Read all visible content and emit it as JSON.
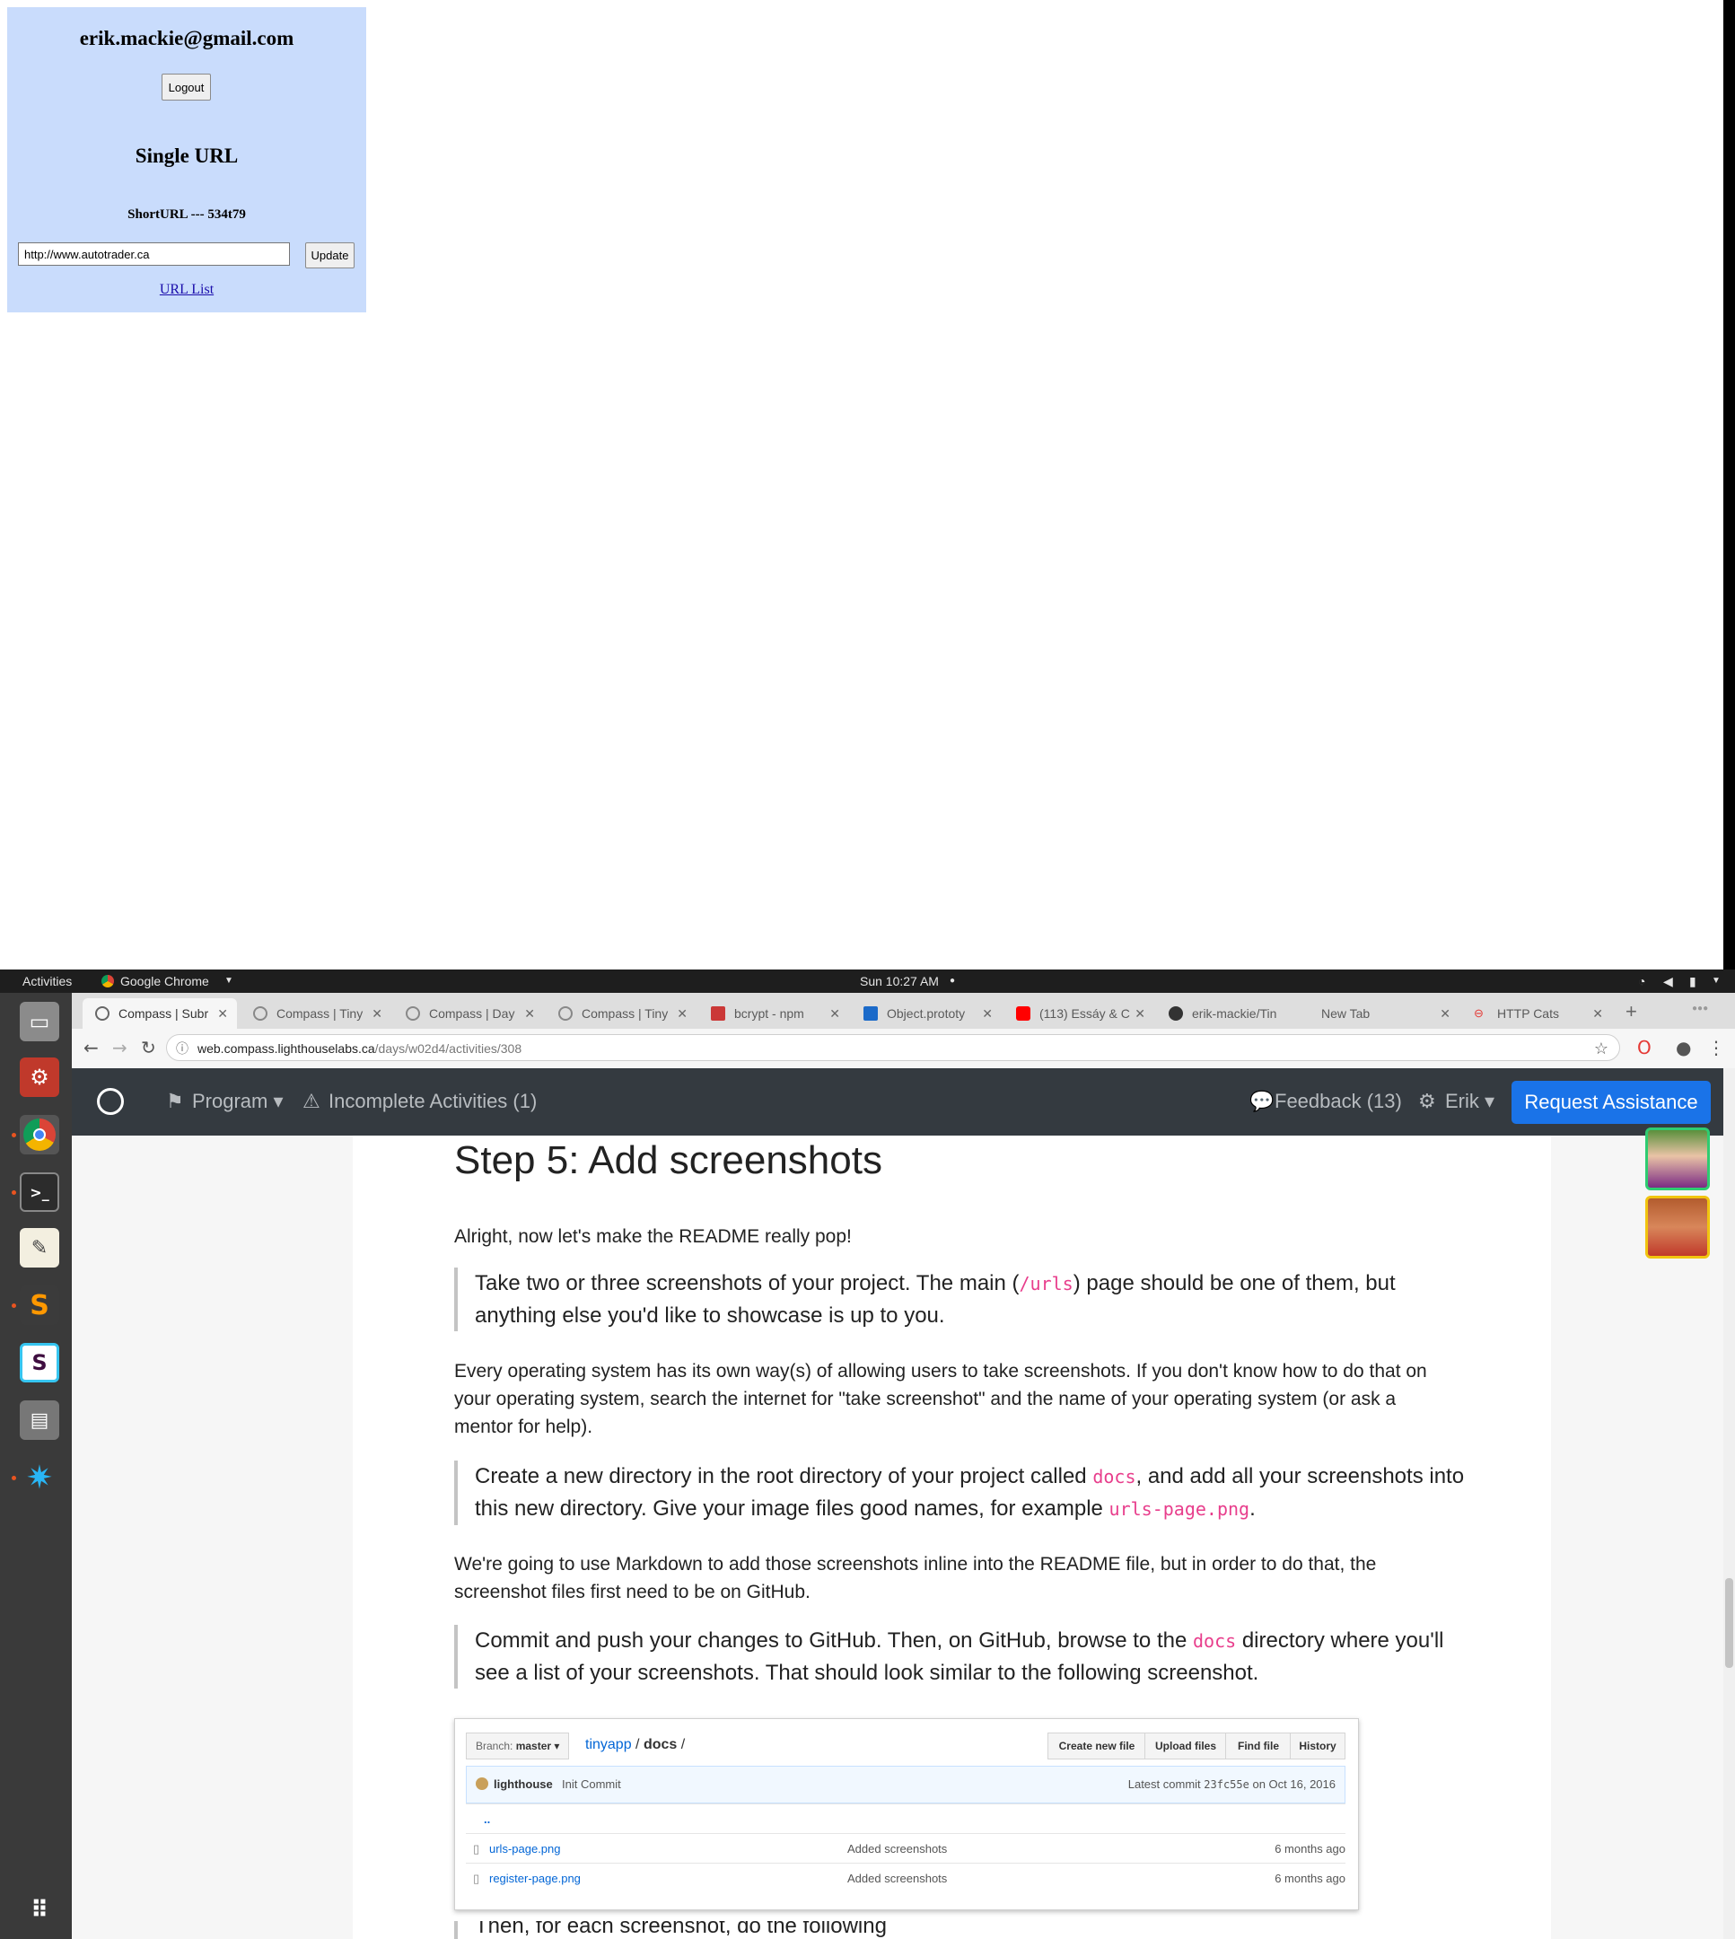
{
  "app": {
    "email": "erik.mackie@gmail.com",
    "logout_label": "Logout",
    "title": "Single URL",
    "shorturl_text": "ShortURL --- 534t79",
    "long_url_value": "http://www.autotrader.ca",
    "update_label": "Update",
    "url_list_link": "URL List"
  },
  "system_bar": {
    "activities": "Activities",
    "app_name": "Google Chrome",
    "clock": "Sun 10:27 AM"
  },
  "browser": {
    "tabs": [
      {
        "label": "Compass | Subr",
        "active": true
      },
      {
        "label": "Compass | Tiny",
        "active": false
      },
      {
        "label": "Compass | Day",
        "active": false
      },
      {
        "label": "Compass | Tiny",
        "active": false
      },
      {
        "label": "bcrypt - npm",
        "active": false
      },
      {
        "label": "Object.prototy",
        "active": false
      },
      {
        "label": "(113) Essáy & C",
        "active": false
      },
      {
        "label": "erik-mackie/Tin",
        "active": false
      },
      {
        "label": "New Tab",
        "active": false
      },
      {
        "label": "HTTP Cats",
        "active": false
      }
    ],
    "url_host": "web.compass.lighthouselabs.ca",
    "url_path": "/days/w02d4/activities/308"
  },
  "site_nav": {
    "program": "Program",
    "incomplete": "Incomplete Activities (1)",
    "feedback": "Feedback (13)",
    "user": "Erik",
    "request_assistance": "Request Assistance"
  },
  "article": {
    "title": "Step 5: Add screenshots",
    "intro": "Alright, now let's make the README really pop!",
    "bq1_a": "Take two or three screenshots of your project. The main (",
    "bq1_code": "/urls",
    "bq1_b": ") page should be one of them, but anything else you'd like to showcase is up to you.",
    "p2": "Every operating system has its own way(s) of allowing users to take screenshots. If you don't know how to do that on your operating system, search the internet for \"take screenshot\" and the name of your operating system (or ask a mentor for help).",
    "bq2_a": "Create a new directory in the root directory of your project called ",
    "bq2_code1": "docs",
    "bq2_b": ", and add all your screenshots into this new directory. Give your image files good names, for example ",
    "bq2_code2": "urls-page.png",
    "bq2_c": ".",
    "p3": "We're going to use Markdown to add those screenshots inline into the README file, but in order to do that, the screenshot files first need to be on GitHub.",
    "bq3_a": "Commit and push your changes to GitHub. Then, on GitHub, browse to the ",
    "bq3_code": "docs",
    "bq3_b": " directory where you'll see a list of your screenshots. That should look similar to the following screenshot.",
    "next_partial": "Then, for each screenshot, do the following"
  },
  "github_shot": {
    "branch_label": "Branch:",
    "branch_name": "master",
    "repo": "tinyapp",
    "sep1": "/",
    "folder": "docs",
    "sep2": "/",
    "buttons": [
      "Create new file",
      "Upload files",
      "Find file",
      "History"
    ],
    "commit_user": "lighthouse",
    "commit_msg": "Init Commit",
    "latest_label": "Latest commit",
    "latest_hash": "23fc55e",
    "latest_date": "on Oct 16, 2016",
    "parent_dir": "..",
    "files": [
      {
        "name": "urls-page.png",
        "message": "Added screenshots",
        "age": "6 months ago"
      },
      {
        "name": "register-page.png",
        "message": "Added screenshots",
        "age": "6 months ago"
      }
    ]
  },
  "colors": {
    "panel_bg": "#c9dcfc",
    "nav_bg": "#343a40",
    "primary": "#1a73e8",
    "code": "#e83e8c",
    "dock_bg": "#3a3a3a"
  }
}
